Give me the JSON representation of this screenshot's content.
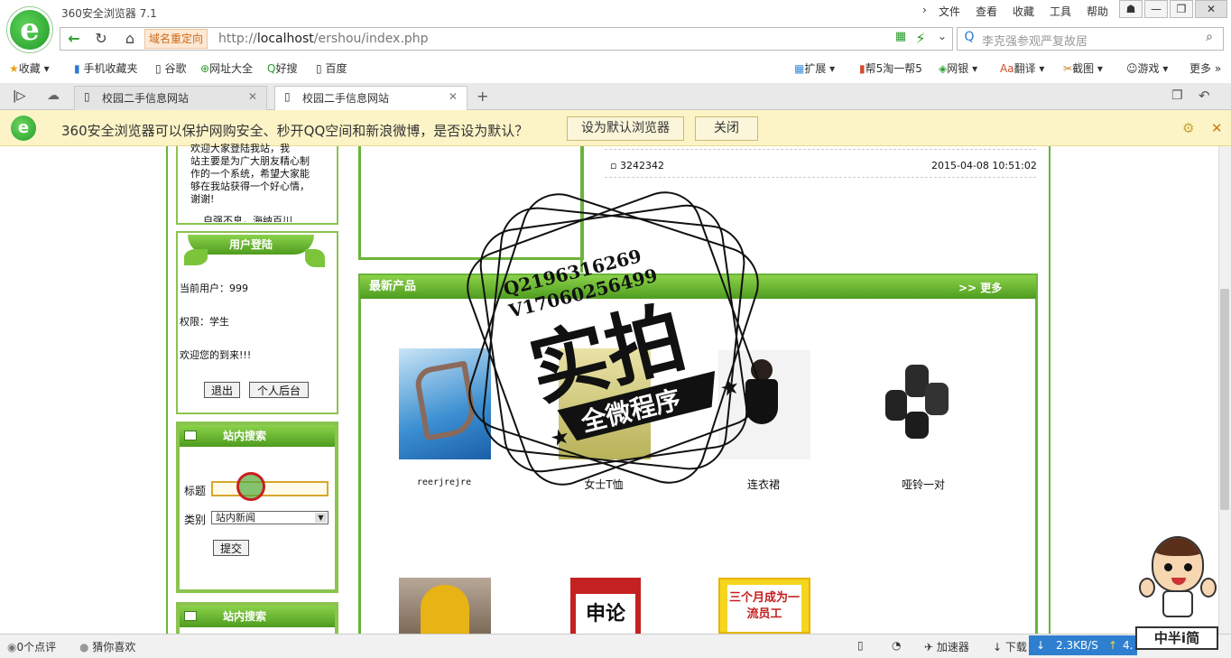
{
  "window": {
    "title": "360安全浏览器 7.1",
    "menus": [
      "文件",
      "查看",
      "收藏",
      "工具",
      "帮助"
    ]
  },
  "navbar": {
    "redirect_label": "域名重定向",
    "url_prefix": "http://",
    "url_host": "localhost",
    "url_path": "/ershou/index.php",
    "search_placeholder": "李克强参观严复故居"
  },
  "bookmarks": {
    "left": [
      "收藏",
      "手机收藏夹",
      "谷歌",
      "网址大全",
      "好搜",
      "百度"
    ],
    "right": [
      "扩展",
      "帮5淘一帮5",
      "网银",
      "翻译",
      "截图",
      "游戏",
      "更多"
    ]
  },
  "tabs": [
    {
      "label": "校园二手信息网站"
    },
    {
      "label": "校园二手信息网站"
    }
  ],
  "notify": {
    "message": "360安全浏览器可以保护网购安全、秒开QQ空间和新浪微博，是否设为默认？",
    "set_default": "设为默认浏览器",
    "close": "关闭"
  },
  "intro": {
    "lines": [
      "欢迎大家登陆我站，我",
      "站主要是为广大朋友精心制",
      "作的一个系统，希望大家能",
      "够在我站获得一个好心情，",
      "谢谢!",
      "    自强不息，海纳百川"
    ]
  },
  "login": {
    "title": "用户登陆",
    "current_user": "当前用户：999",
    "role": "权限：学生",
    "welcome": "欢迎您的到来!!!",
    "logout": "退出",
    "backend": "个人后台"
  },
  "search": {
    "title": "站内搜索",
    "title_label": "标题",
    "title_value": "",
    "category_label": "类别",
    "category_value": "站内新闻",
    "submit": "提交"
  },
  "search2": {
    "title": "站内搜索"
  },
  "news": {
    "item": "3242342",
    "date": "2015-04-08 10:51:02"
  },
  "products": {
    "title": "最新产品",
    "more": ">> 更多",
    "row1": [
      "reerjrejre",
      "女士T恤",
      "连衣裙",
      "哑铃一对"
    ],
    "row2_img_texts": [
      "",
      "申论",
      "三个月成为一流员工"
    ]
  },
  "watermark": {
    "contact1": "Q2196316269",
    "contact2": "V17060256499",
    "main": "实拍",
    "sub": "全微程序"
  },
  "corner_badge": "中半i简",
  "status": {
    "comments": "0个点评",
    "guess": "猜你喜欢",
    "accelerator": "加速器",
    "download": "下载",
    "speed": "2.3KB/S",
    "extra": "4."
  }
}
